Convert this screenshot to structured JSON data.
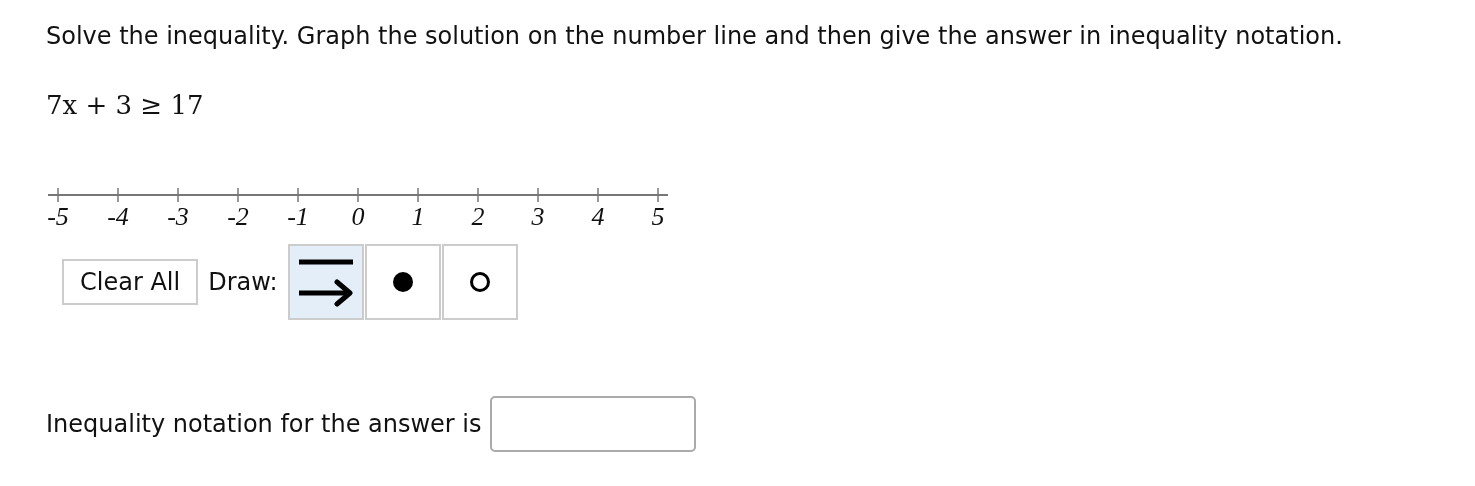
{
  "instruction": "Solve the inequality. Graph the solution on the number line and then give the answer in inequality notation.",
  "equation": "7x + 3 ≥ 17",
  "number_line": {
    "labels": [
      "-5",
      "-4",
      "-3",
      "-2",
      "-1",
      "0",
      "1",
      "2",
      "3",
      "4",
      "5"
    ]
  },
  "toolbar": {
    "clear_button": "Clear All",
    "draw_label": "Draw:",
    "tools": [
      {
        "kind": "ray",
        "selected": true
      },
      {
        "kind": "closed-dot",
        "selected": false
      },
      {
        "kind": "open-dot",
        "selected": false
      }
    ]
  },
  "answer": {
    "label": "Inequality notation for the answer is"
  }
}
